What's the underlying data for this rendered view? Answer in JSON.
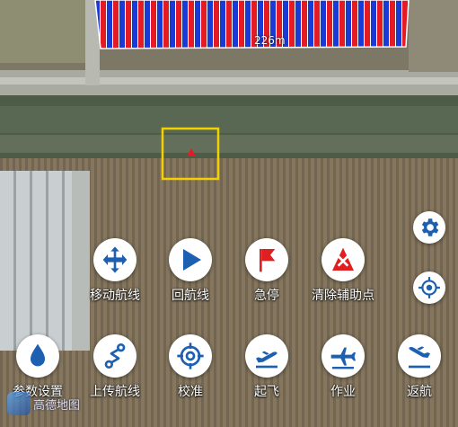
{
  "map": {
    "scale_label": "226m",
    "logo_text": "高德地图"
  },
  "actions_row1": [
    {
      "label": "移动航线",
      "icon": "move-arrows-icon"
    },
    {
      "label": "回航线",
      "icon": "play-icon"
    },
    {
      "label": "急停",
      "icon": "red-flag-icon"
    },
    {
      "label": "清除辅助点",
      "icon": "clear-points-icon"
    }
  ],
  "actions_row2": [
    {
      "label": "参数设置",
      "icon": "water-drop-icon"
    },
    {
      "label": "上传航线",
      "icon": "upload-route-icon"
    },
    {
      "label": "校准",
      "icon": "calibrate-crosshair-icon"
    },
    {
      "label": "起飞",
      "icon": "takeoff-plane-icon"
    },
    {
      "label": "作业",
      "icon": "work-plane-icon"
    },
    {
      "label": "返航",
      "icon": "return-plane-icon"
    }
  ],
  "colors": {
    "icon_blue": "#1d5fb0",
    "accent_red": "#e02020",
    "route_red": "#e51b23",
    "route_blue": "#1a3ad6",
    "selection_yellow": "#f5d000"
  }
}
